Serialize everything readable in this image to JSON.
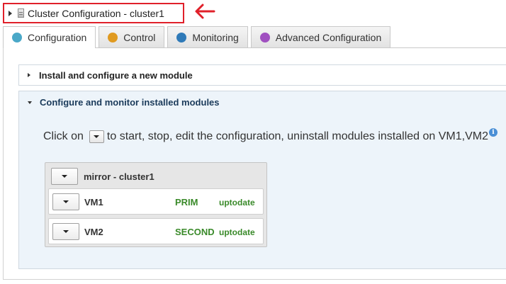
{
  "header": {
    "title": "Cluster Configuration - cluster1"
  },
  "tabs": [
    {
      "label": "Configuration",
      "icon": "configuration-icon",
      "color": "#4aa8c8",
      "active": true
    },
    {
      "label": "Control",
      "icon": "control-icon",
      "color": "#e09a20",
      "active": false
    },
    {
      "label": "Monitoring",
      "icon": "monitoring-icon",
      "color": "#2f7ab8",
      "active": false
    },
    {
      "label": "Advanced Configuration",
      "icon": "advanced-icon",
      "color": "#a050c0",
      "active": false
    }
  ],
  "accordion": {
    "install": {
      "label": "Install and configure a new module",
      "expanded": false
    },
    "monitor": {
      "label": "Configure and monitor installed modules",
      "expanded": true
    }
  },
  "instructions": {
    "before": "Click on",
    "after": "to start, stop, edit the configuration, uninstall modules installed on VM1,VM2"
  },
  "cluster": {
    "name": "mirror - cluster1",
    "vms": [
      {
        "name": "VM1",
        "role": "PRIM",
        "status": "uptodate"
      },
      {
        "name": "VM2",
        "role": "SECOND",
        "status": "uptodate"
      }
    ]
  },
  "colors": {
    "highlight": "#e0202a",
    "status_green": "#3a8a2a"
  }
}
